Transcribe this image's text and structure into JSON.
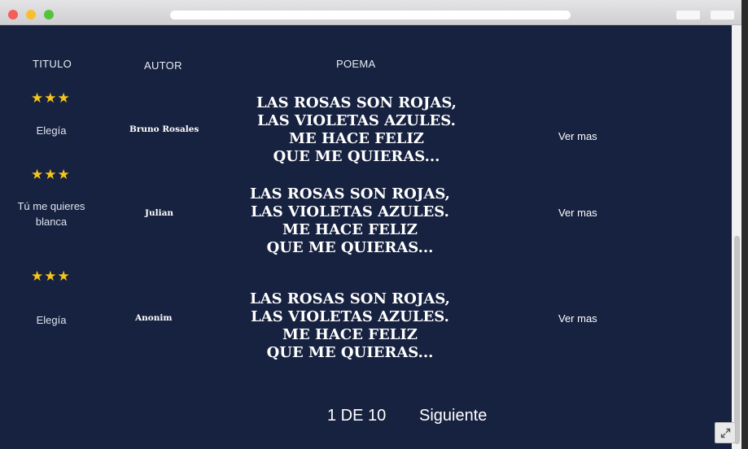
{
  "table": {
    "headers": {
      "titulo": "TITULO",
      "autor": "AUTOR",
      "poema": "POEMA"
    },
    "rows": [
      {
        "rating": "★★★",
        "rating_value": 3,
        "titulo": "Elegía",
        "autor": "Bruno Rosales",
        "poema": [
          "LAS ROSAS SON ROJAS,",
          "LAS VIOLETAS AZULES.",
          "ME HACE FELIZ",
          "QUE ME QUIERAS..."
        ],
        "ver_mas": "Ver mas"
      },
      {
        "rating": "★★★",
        "rating_value": 3,
        "titulo": "Tú me quieres blanca",
        "autor": "Julian",
        "poema": [
          "LAS ROSAS SON ROJAS,",
          "LAS VIOLETAS AZULES.",
          "ME HACE FELIZ",
          "QUE ME QUIERAS..."
        ],
        "ver_mas": "Ver mas"
      },
      {
        "rating": "★★★",
        "rating_value": 3,
        "titulo": "Elegía",
        "autor": "Anonim",
        "poema": [
          "LAS ROSAS SON ROJAS,",
          "LAS VIOLETAS AZULES.",
          "ME HACE FELIZ",
          "QUE ME QUIERAS..."
        ],
        "ver_mas": "Ver mas"
      }
    ]
  },
  "pagination": {
    "current": "1 DE 10",
    "next_label": "Siguiente"
  },
  "colors": {
    "background": "#172240",
    "star": "#f5c518",
    "text": "#ffffff"
  },
  "icons": {
    "expand": "expand-icon"
  }
}
